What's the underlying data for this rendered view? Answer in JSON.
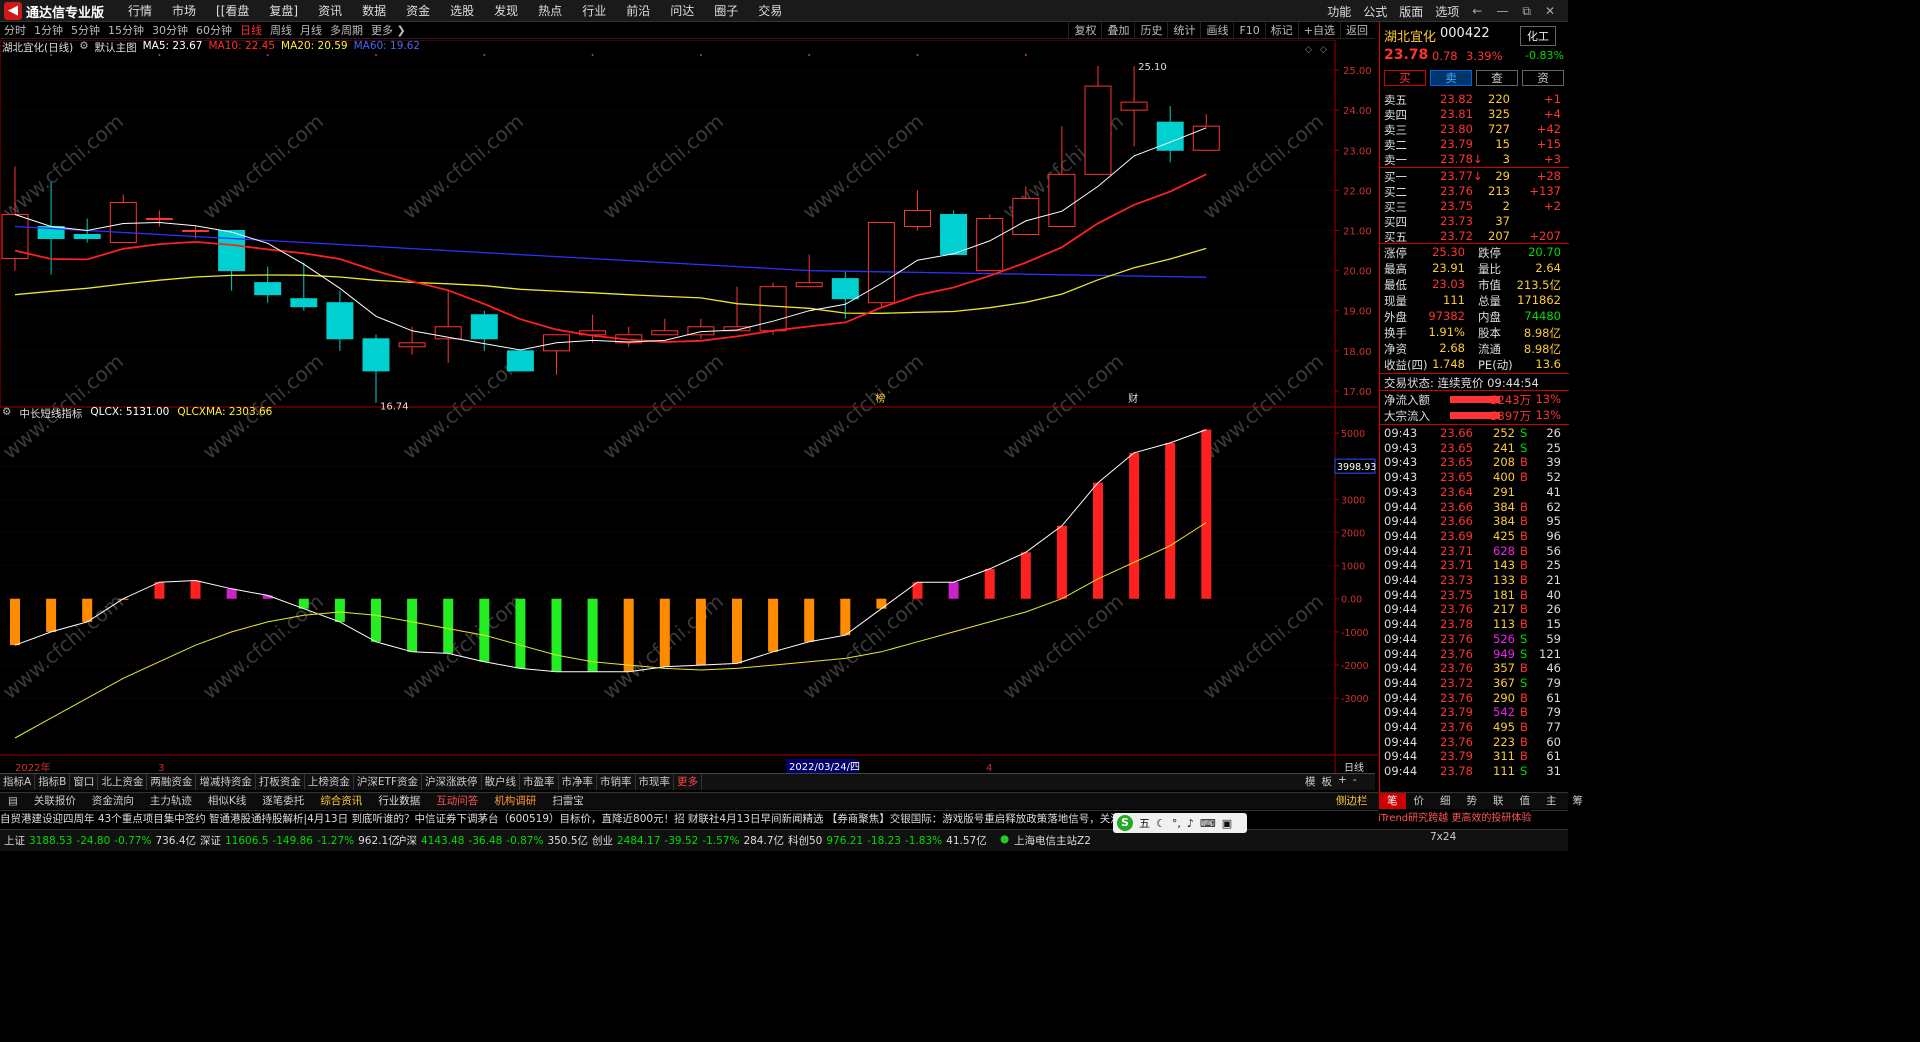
{
  "app": {
    "logo": "通达信专业版",
    "menu": [
      "行情",
      "市场",
      "[[看盘",
      "复盘]",
      "资讯",
      "数据",
      "资金",
      "选股",
      "发现",
      "热点",
      "行业",
      "前沿",
      "问达",
      "圈子",
      "交易"
    ],
    "right_menu": [
      "功能",
      "公式",
      "版面",
      "选项"
    ]
  },
  "periods": [
    "分时",
    "1分钟",
    "5分钟",
    "15分钟",
    "30分钟",
    "60分钟",
    "日线",
    "周线",
    "月线",
    "多周期",
    "更多 ❯"
  ],
  "active_period": "日线",
  "tools": [
    "复权",
    "叠加",
    "历史",
    "统计",
    "画线",
    "F10",
    "标记",
    "+自选",
    "返回"
  ],
  "legend": {
    "name": "湖北宜化(日线)",
    "main": "默认主图",
    "ma5": "MA5: 23.67",
    "ma10": "MA10: 22.45",
    "ma20": "MA20: 20.59",
    "ma60": "MA60: 19.62"
  },
  "indicator": {
    "name": "中长短线指标",
    "qlcx": "QLCX: 5131.00",
    "qlcxma": "QLCXMA: 2303.66"
  },
  "chart_data": [
    {
      "type": "candlestick",
      "y_ticks": [
        "25.00",
        "24.00",
        "23.00",
        "22.00",
        "21.00",
        "20.00",
        "19.00",
        "18.00",
        "17.00"
      ],
      "ylim": [
        16.6,
        25.4
      ],
      "candles": [
        [
          20.3,
          21.4,
          20.0,
          22.6
        ],
        [
          21.1,
          20.8,
          19.9,
          22.2
        ],
        [
          20.9,
          20.8,
          20.7,
          21.3
        ],
        [
          20.7,
          21.7,
          20.7,
          21.9
        ],
        [
          21.3,
          21.3,
          21.1,
          21.5
        ],
        [
          21.0,
          21.0,
          20.8,
          21.1
        ],
        [
          21.0,
          20.0,
          19.5,
          21.0
        ],
        [
          19.7,
          19.4,
          19.2,
          20.1
        ],
        [
          19.3,
          19.1,
          19.0,
          20.2
        ],
        [
          19.2,
          18.3,
          18.0,
          19.5
        ],
        [
          18.3,
          17.5,
          16.7,
          18.4
        ],
        [
          18.1,
          18.2,
          17.9,
          18.6
        ],
        [
          18.3,
          18.6,
          17.7,
          19.5
        ],
        [
          18.9,
          18.3,
          18.0,
          19.0
        ],
        [
          18.0,
          17.5,
          17.5,
          18.0
        ],
        [
          18.0,
          18.4,
          17.4,
          18.4
        ],
        [
          18.4,
          18.5,
          18.2,
          18.9
        ],
        [
          18.2,
          18.4,
          18.1,
          18.6
        ],
        [
          18.4,
          18.5,
          18.4,
          18.8
        ],
        [
          18.4,
          18.6,
          18.3,
          18.8
        ],
        [
          18.5,
          18.6,
          18.5,
          19.6
        ],
        [
          18.5,
          19.6,
          18.4,
          19.7
        ],
        [
          19.6,
          19.7,
          19.6,
          20.4
        ],
        [
          19.8,
          19.3,
          18.8,
          20.0
        ],
        [
          19.2,
          21.2,
          19.1,
          21.2
        ],
        [
          21.1,
          21.5,
          21.0,
          22.0
        ],
        [
          21.4,
          20.4,
          20.4,
          21.5
        ],
        [
          20.0,
          21.3,
          20.0,
          21.4
        ],
        [
          20.9,
          21.8,
          20.9,
          22.1
        ],
        [
          21.1,
          22.4,
          21.1,
          23.6
        ],
        [
          22.4,
          24.6,
          22.4,
          25.1
        ],
        [
          24.0,
          24.2,
          23.1,
          25.1
        ],
        [
          23.7,
          23.0,
          22.7,
          24.1
        ],
        [
          23.0,
          23.6,
          23.0,
          23.9
        ]
      ],
      "annotations": [
        "25.10",
        "16.74",
        "榜",
        "财"
      ]
    },
    {
      "type": "bar",
      "series": [
        {
          "name": "QLCX"
        },
        {
          "name": "QLCXMA"
        }
      ],
      "y_ticks": [
        "5000",
        "4000",
        "3000",
        "2000",
        "1000",
        "0.00",
        "-1000",
        "-2000",
        "-3000"
      ],
      "ylim": [
        -4200,
        5300
      ],
      "current": "3998.93",
      "values": [
        -1400,
        -1000,
        -700,
        0,
        500,
        550,
        300,
        100,
        -300,
        -700,
        -1300,
        -1600,
        -1650,
        -1900,
        -2100,
        -2200,
        -2200,
        -2200,
        -2050,
        -2000,
        -1950,
        -1600,
        -1300,
        -1100,
        -300,
        500,
        500,
        900,
        1400,
        2200,
        3500,
        4400,
        4700,
        5100
      ],
      "ma_values": [
        -4200,
        -3600,
        -3000,
        -2400,
        -1900,
        -1400,
        -1000,
        -700,
        -500,
        -400,
        -500,
        -700,
        -900,
        -1100,
        -1400,
        -1700,
        -1900,
        -2000,
        -2100,
        -2150,
        -2100,
        -2000,
        -1900,
        -1800,
        -1600,
        -1300,
        -1000,
        -700,
        -400,
        0,
        600,
        1100,
        1600,
        2300
      ],
      "colors": [
        "#ff8c00",
        "#ff8c00",
        "#ff8c00",
        "#ff8c00",
        "#ff2020",
        "#ff2020",
        "#cc22cc",
        "#cc22cc",
        "#22ee22",
        "#22ee22",
        "#22ee22",
        "#22ee22",
        "#22ee22",
        "#22ee22",
        "#22ee22",
        "#22ee22",
        "#22ee22",
        "#ff8c00",
        "#ff8c00",
        "#ff8c00",
        "#ff8c00",
        "#ff8c00",
        "#ff8c00",
        "#ff8c00",
        "#ff8c00",
        "#ff2020",
        "#cc22cc",
        "#ff2020",
        "#ff2020",
        "#ff2020",
        "#ff2020",
        "#ff2020",
        "#ff2020",
        "#ff2020"
      ]
    }
  ],
  "x_axis": {
    "left": "2022年",
    "m1": "3",
    "date": "2022/03/24/四",
    "m2": "4",
    "right": "日线"
  },
  "quote": {
    "name": "湖北宜化",
    "code": "000422",
    "industry": "化工",
    "price": "23.78",
    "change": "0.78",
    "pct": "3.39%",
    "ind_pct": "-0.83%",
    "buttons": [
      "买",
      "卖",
      "查",
      "资"
    ],
    "asks": [
      [
        "卖五",
        "23.82",
        "220",
        "+1"
      ],
      [
        "卖四",
        "23.81",
        "325",
        "+4"
      ],
      [
        "卖三",
        "23.80",
        "727",
        "+42"
      ],
      [
        "卖二",
        "23.79",
        "15",
        "+15"
      ],
      [
        "卖一",
        "23.78↓",
        "3",
        "+3"
      ]
    ],
    "bids": [
      [
        "买一",
        "23.77↓",
        "29",
        "+28"
      ],
      [
        "买二",
        "23.76",
        "213",
        "+137"
      ],
      [
        "买三",
        "23.75",
        "2",
        "+2"
      ],
      [
        "买四",
        "23.73",
        "37",
        ""
      ],
      [
        "买五",
        "23.72",
        "207",
        "+207"
      ]
    ],
    "stats": [
      [
        "涨停",
        "25.30",
        "跌停",
        "20.70"
      ],
      [
        "最高",
        "23.91",
        "量比",
        "2.64"
      ],
      [
        "最低",
        "23.03",
        "市值",
        "213.5亿"
      ],
      [
        "现量",
        "111",
        "总量",
        "171862"
      ],
      [
        "外盘",
        "97382",
        "内盘",
        "74480"
      ],
      [
        "换手",
        "1.91%",
        "股本",
        "8.98亿"
      ],
      [
        "净资",
        "2.68",
        "流通",
        "8.98亿"
      ],
      [
        "收益(四)",
        "1.748",
        "PE(动)",
        "13.6"
      ]
    ],
    "trade_status": "交易状态: 连续竞价 09:44:54",
    "flows": [
      [
        "净流入额",
        "5243万",
        "13%"
      ],
      [
        "大宗流入",
        "5397万",
        "13%"
      ]
    ],
    "ticks": [
      [
        "09:43",
        "23.66",
        "252",
        "S",
        "26"
      ],
      [
        "09:43",
        "23.65",
        "241",
        "S",
        "25"
      ],
      [
        "09:43",
        "23.65",
        "208",
        "B",
        "39"
      ],
      [
        "09:43",
        "23.65",
        "400",
        "B",
        "52"
      ],
      [
        "09:43",
        "23.64",
        "291",
        "",
        "41"
      ],
      [
        "09:44",
        "23.66",
        "384",
        "B",
        "62"
      ],
      [
        "09:44",
        "23.66",
        "384",
        "B",
        "95"
      ],
      [
        "09:44",
        "23.69",
        "425",
        "B",
        "96"
      ],
      [
        "09:44",
        "23.71",
        "628",
        "B",
        "56"
      ],
      [
        "09:44",
        "23.71",
        "143",
        "B",
        "25"
      ],
      [
        "09:44",
        "23.73",
        "133",
        "B",
        "21"
      ],
      [
        "09:44",
        "23.75",
        "181",
        "B",
        "40"
      ],
      [
        "09:44",
        "23.76",
        "217",
        "B",
        "26"
      ],
      [
        "09:44",
        "23.78",
        "113",
        "B",
        "15"
      ],
      [
        "09:44",
        "23.76",
        "526",
        "S",
        "59"
      ],
      [
        "09:44",
        "23.76",
        "949",
        "S",
        "121"
      ],
      [
        "09:44",
        "23.76",
        "357",
        "B",
        "46"
      ],
      [
        "09:44",
        "23.72",
        "367",
        "S",
        "79"
      ],
      [
        "09:44",
        "23.76",
        "290",
        "B",
        "61"
      ],
      [
        "09:44",
        "23.79",
        "542",
        "B",
        "79"
      ],
      [
        "09:44",
        "23.76",
        "495",
        "B",
        "77"
      ],
      [
        "09:44",
        "23.76",
        "223",
        "B",
        "60"
      ],
      [
        "09:44",
        "23.79",
        "311",
        "B",
        "61"
      ],
      [
        "09:44",
        "23.78",
        "111",
        "S",
        "31"
      ]
    ],
    "tabs": [
      "笔",
      "价",
      "细",
      "势",
      "联",
      "值",
      "主",
      "筹"
    ]
  },
  "bottom_tabs": [
    "指标A",
    "指标B",
    "窗口",
    "北上资金",
    "两融资金",
    "增减持资金",
    "打板资金",
    "上榜资金",
    "沪深ETF资金",
    "沪深涨跌停",
    "散户线",
    "市盈率",
    "市净率",
    "市销率",
    "市现率",
    "更多"
  ],
  "bottom_right": [
    "模",
    "板",
    "+",
    "-"
  ],
  "info_tabs": [
    "关联报价",
    "资金流向",
    "主力轨迹",
    "相似K线",
    "逐笔委托",
    "综合资讯",
    "行业数据",
    "互动问答",
    "机构调研",
    "扫雷宝"
  ],
  "info_right": "侧边栏",
  "ticker": "自贸港建设迎四周年 43个重点项目集中签约      智通港股通持股解析|4月13日      到底听谁的？中信证券下调茅台（600519）目标价，直降近800元！招      财联社4月13日早间新闻精选      【券商聚焦】交银国际：游戏版号重启释放政策落地信号，关注具体实施      4月13日      海外",
  "itrend": "iTrend研究跨越 更高效的投研体验",
  "indices": [
    [
      "上证",
      "3188.53",
      "-24.80",
      "-0.77%",
      "736.4亿"
    ],
    [
      "深证",
      "11606.5",
      "-149.86",
      "-1.27%",
      "962.1亿"
    ],
    [
      "沪深",
      "4143.48",
      "-36.48",
      "-0.87%",
      "350.5亿"
    ],
    [
      "创业",
      "2484.17",
      "-39.52",
      "-1.57%",
      "284.7亿"
    ],
    [
      "科创50",
      "976.21",
      "-18.23",
      "-1.83%",
      "41.57亿"
    ]
  ],
  "server": "上海电信主站Z2",
  "ime": "五",
  "clock": "7x24",
  "watermark": "www.cfchi.com",
  "colors": {
    "up": "#ff3333",
    "down": "#00d0d0",
    "ma5": "#ffffff",
    "ma10": "#ff2020",
    "ma20": "#e8e830",
    "ma60": "#3030ff",
    "grid": "#5a0000"
  }
}
